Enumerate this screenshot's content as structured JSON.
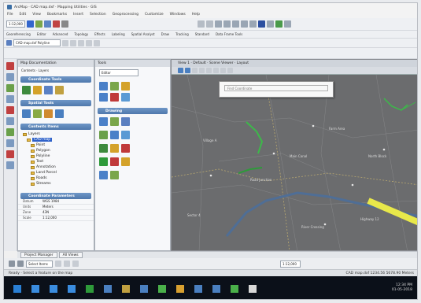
{
  "window": {
    "title": "ArcMap · CAD map.dxf · Mapping Utilities · GIS",
    "menu": [
      "File",
      "Edit",
      "View",
      "Bookmarks",
      "Insert",
      "Selection",
      "Geoprocessing",
      "Customize",
      "Windows",
      "Help"
    ]
  },
  "toolbar": {
    "scale": "1:12,000",
    "tabs2": [
      "Georeferencing",
      "Editor",
      "Advanced",
      "Topology",
      "Effects",
      "Labeling",
      "Spatial Analyst",
      "Draw",
      "Tracking",
      "Standard",
      "Data Frame Tools"
    ],
    "layer_combo": "CAD map.dxf Polyline"
  },
  "panels": {
    "left_title": "Map Documentation",
    "left_sub": "Contents  ·  Layers",
    "group1": "Coordinate Tools",
    "group2": "Spatial Tools",
    "group3": "Contents Items",
    "tree": [
      "Layers",
      "CAD map",
      "Point",
      "Polygon",
      "Polyline",
      "Text",
      "Annotation",
      "Land Parcel",
      "Roads",
      "Streams"
    ],
    "group4": "Coordinate Parameters",
    "props": [
      {
        "k": "Datum",
        "v": "WGS 1984"
      },
      {
        "k": "Units",
        "v": "Meters"
      },
      {
        "k": "Zone",
        "v": "43N"
      },
      {
        "k": "Scale",
        "v": "1:12,000"
      }
    ],
    "mid_title": "Tools",
    "mid_combo": "Editor",
    "mid_group": "Drawing"
  },
  "map": {
    "header": "View 1 · Default · Scene Viewer · Layout",
    "popup_placeholder": "Find Coordinate",
    "labels": [
      "Village A",
      "Road Junction",
      "Main Canal",
      "Farm Area",
      "Highway 12",
      "Sector 4",
      "River Crossing",
      "North Block"
    ]
  },
  "bottom": {
    "tabs": [
      "Project Manager",
      "All Views"
    ],
    "select_combo": "Select Items",
    "scale_combo": "1:12,000"
  },
  "status": {
    "left": "Ready · Select a feature on the map",
    "right": "CAD map.dxf  1234.56  5678.90 Meters"
  },
  "taskbar": {
    "time": "12:34 PM",
    "date": "01-05-2018"
  },
  "colors": {
    "map_bg": "#6b6c6e",
    "road_yellow": "#e8e84a",
    "green_feature": "#3db84a",
    "blue_road": "#4f6e96"
  }
}
